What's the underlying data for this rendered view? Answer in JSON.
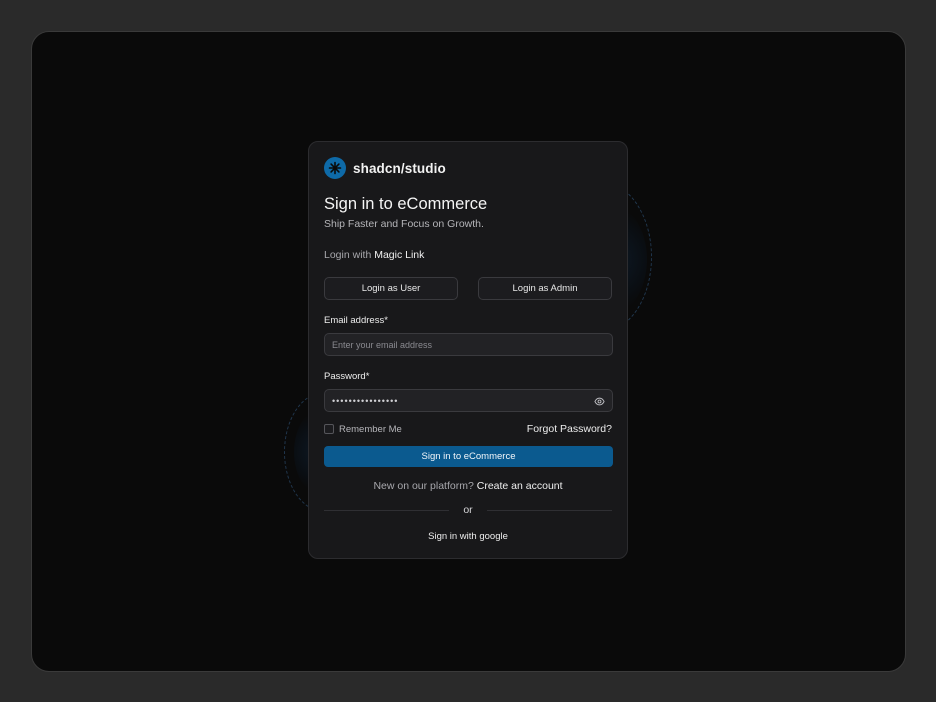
{
  "brand": {
    "name": "shadcn/studio",
    "logo_icon": "asterisk-logo-icon",
    "accent": "#0e6aa8"
  },
  "heading": {
    "title": "Sign in to eCommerce",
    "subtitle": "Ship Faster and Focus on Growth."
  },
  "magic_link": {
    "prefix": "Login with",
    "link": "Magic Link"
  },
  "quick_login": {
    "user_label": "Login as User",
    "admin_label": "Login as Admin"
  },
  "email": {
    "label": "Email address*",
    "placeholder": "Enter your email address",
    "value": ""
  },
  "password": {
    "label": "Password*",
    "value": "••••••••••••••••",
    "toggle_icon": "eye-icon"
  },
  "remember": {
    "label": "Remember Me",
    "checked": false
  },
  "forgot_label": "Forgot Password?",
  "submit_label": "Sign in to eCommerce",
  "signup": {
    "prefix": "New on our platform?",
    "link": "Create an account"
  },
  "divider_label": "or",
  "google_label": "Sign in with google"
}
